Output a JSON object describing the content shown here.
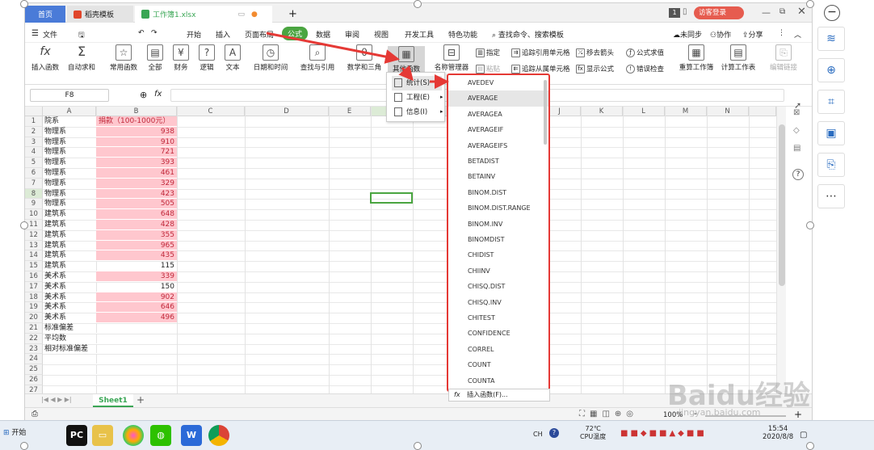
{
  "tabs": {
    "home": "首页",
    "template": "稻壳模板",
    "workbook": "工作簿1.xlsx",
    "new_tab": "+",
    "login": "访客登录",
    "page_badge": "1"
  },
  "menu": {
    "file": "文件",
    "items": [
      "开始",
      "插入",
      "页面布局",
      "公式",
      "数据",
      "审阅",
      "视图",
      "开发工具",
      "特色功能"
    ],
    "search": "查找命令、搜索模板",
    "sync": "未同步",
    "collab": "协作",
    "share": "分享"
  },
  "ribbon": {
    "insert_fn": "插入函数",
    "autosum": "自动求和",
    "common": "常用函数",
    "all": "全部",
    "finance": "财务",
    "logic": "逻辑",
    "text": "文本",
    "datetime": "日期和时间",
    "lookup": "查找与引用",
    "math": "数学和三角",
    "other": "其他函数",
    "name_mgr": "名称管理器",
    "specify": "指定",
    "paste": "粘贴",
    "trace_prec": "追踪引用单元格",
    "trace_dep": "追踪从属单元格",
    "remove_arrows": "移去箭头",
    "show_formula": "显示公式",
    "eval": "公式求值",
    "error_check": "错误检查",
    "recalc": "重算工作簿",
    "calc_sheet": "计算工作表",
    "edit_link": "编辑链接"
  },
  "formula_bar": {
    "cell_ref": "F8",
    "fx": "fx"
  },
  "columns": [
    "A",
    "B",
    "C",
    "D",
    "E",
    "F",
    "G",
    "H",
    "I",
    "J",
    "K",
    "L",
    "M",
    "N"
  ],
  "rows": [
    {
      "n": "1",
      "a": "院系",
      "b": "捐款（100-1000元）",
      "pink": true
    },
    {
      "n": "2",
      "a": "物理系",
      "b": "938",
      "pink": true
    },
    {
      "n": "3",
      "a": "物理系",
      "b": "910",
      "pink": true
    },
    {
      "n": "4",
      "a": "物理系",
      "b": "721",
      "pink": true
    },
    {
      "n": "5",
      "a": "物理系",
      "b": "393",
      "pink": true
    },
    {
      "n": "6",
      "a": "物理系",
      "b": "461",
      "pink": true
    },
    {
      "n": "7",
      "a": "物理系",
      "b": "329",
      "pink": true
    },
    {
      "n": "8",
      "a": "物理系",
      "b": "423",
      "pink": true
    },
    {
      "n": "9",
      "a": "物理系",
      "b": "505",
      "pink": true
    },
    {
      "n": "10",
      "a": "建筑系",
      "b": "648",
      "pink": true
    },
    {
      "n": "11",
      "a": "建筑系",
      "b": "428",
      "pink": true
    },
    {
      "n": "12",
      "a": "建筑系",
      "b": "355",
      "pink": true
    },
    {
      "n": "13",
      "a": "建筑系",
      "b": "965",
      "pink": true
    },
    {
      "n": "14",
      "a": "建筑系",
      "b": "435",
      "pink": true
    },
    {
      "n": "15",
      "a": "建筑系",
      "b": "115",
      "pink": false
    },
    {
      "n": "16",
      "a": "美术系",
      "b": "339",
      "pink": true
    },
    {
      "n": "17",
      "a": "美术系",
      "b": "150",
      "pink": false
    },
    {
      "n": "18",
      "a": "美术系",
      "b": "902",
      "pink": true
    },
    {
      "n": "19",
      "a": "美术系",
      "b": "646",
      "pink": true
    },
    {
      "n": "20",
      "a": "美术系",
      "b": "496",
      "pink": true
    },
    {
      "n": "21",
      "a": "标准偏差",
      "b": "",
      "pink": false
    },
    {
      "n": "22",
      "a": "平均数",
      "b": "",
      "pink": false
    },
    {
      "n": "23",
      "a": "相对标准偏差",
      "b": "",
      "pink": false
    },
    {
      "n": "24",
      "a": "",
      "b": "",
      "pink": false
    },
    {
      "n": "25",
      "a": "",
      "b": "",
      "pink": false
    },
    {
      "n": "26",
      "a": "",
      "b": "",
      "pink": false
    },
    {
      "n": "27",
      "a": "",
      "b": "",
      "pink": false
    }
  ],
  "submenu": {
    "stats": "统计(S)",
    "engineering": "工程(E)",
    "info": "信息(I)"
  },
  "functions": [
    "AVEDEV",
    "AVERAGE",
    "AVERAGEA",
    "AVERAGEIF",
    "AVERAGEIFS",
    "BETADIST",
    "BETAINV",
    "BINOM.DIST",
    "BINOM.DIST.RANGE",
    "BINOM.INV",
    "BINOMDIST",
    "CHIDIST",
    "CHIINV",
    "CHISQ.DIST",
    "CHISQ.INV",
    "CHITEST",
    "CONFIDENCE",
    "CORREL",
    "COUNT",
    "COUNTA"
  ],
  "insert_fn_footer": "插入函数(F)...",
  "sheet_tab": "Sheet1",
  "status": {
    "zoom": "100%",
    "minus": "-",
    "plus": "+"
  },
  "taskbar": {
    "start": "开始",
    "temp": "72℃",
    "cpu": "CPU温度",
    "time": "15:54",
    "date": "2020/8/8",
    "lang": "CH"
  },
  "watermark": "Baidu经验",
  "watermark_url": "jingyan.baidu.com",
  "colors": {
    "accent_green": "#4aa540",
    "highlight_red": "#e53935",
    "pink_fill": "#ffc7ce",
    "tab_blue": "#4a7bd8"
  }
}
